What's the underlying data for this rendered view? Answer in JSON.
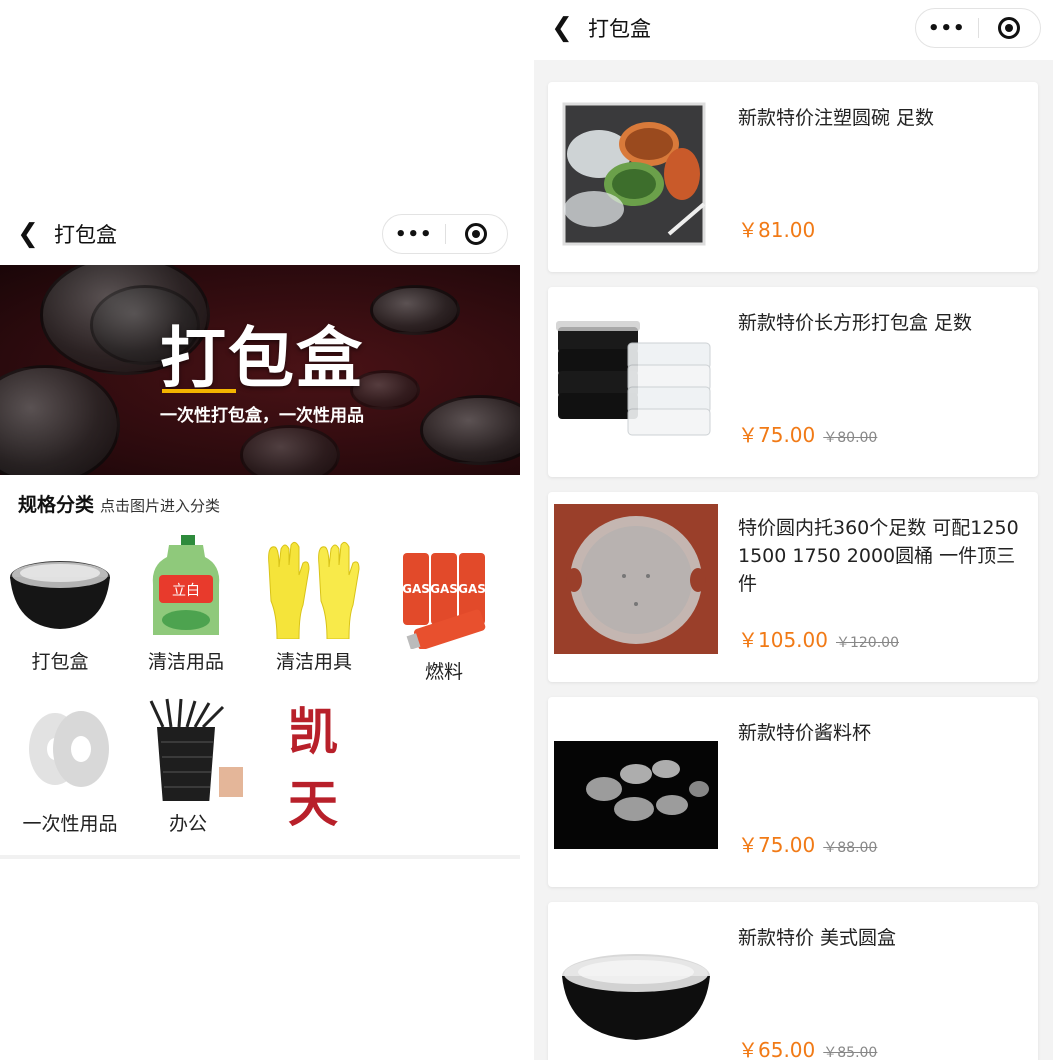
{
  "left": {
    "nav": {
      "title": "打包盒",
      "back_icon": "chevron-left-icon",
      "more_label": "•••"
    },
    "banner": {
      "title": "打包盒",
      "subtitle": "一次性打包盒，一次性用品"
    },
    "section": {
      "title": "规格分类",
      "hint": "点击图片进入分类"
    },
    "categories": [
      {
        "label": "打包盒",
        "icon": "bowl-icon"
      },
      {
        "label": "清洁用品",
        "icon": "detergent-bottle-icon"
      },
      {
        "label": "清洁用具",
        "icon": "rubber-gloves-icon"
      },
      {
        "label": "燃料",
        "icon": "gas-can-icon"
      },
      {
        "label": "一次性用品",
        "icon": "paper-roll-icon"
      },
      {
        "label": "办公",
        "icon": "pen-holder-icon"
      },
      {
        "label": "凯 天",
        "icon": "brand-logo"
      }
    ]
  },
  "right": {
    "nav": {
      "title": "打包盒",
      "back_icon": "chevron-left-icon",
      "more_label": "•••"
    },
    "products": [
      {
        "name": "新款特价注塑圆碗 足数",
        "price": "￥81.00",
        "original_price": ""
      },
      {
        "name": "新款特价长方形打包盒 足数",
        "price": "￥75.00",
        "original_price": "￥80.00"
      },
      {
        "name": "特价圆内托360个足数 可配1250 1500 1750 2000圆桶 一件顶三件",
        "price": "￥105.00",
        "original_price": "￥120.00"
      },
      {
        "name": "新款特价酱料杯",
        "price": "￥75.00",
        "original_price": "￥88.00"
      },
      {
        "name": "新款特价 美式圆盒",
        "price": "￥65.00",
        "original_price": "￥85.00"
      }
    ]
  },
  "colors": {
    "price": "#f17a16",
    "banner_bg": "#3a0d11",
    "banner_accent": "#f3b400"
  }
}
